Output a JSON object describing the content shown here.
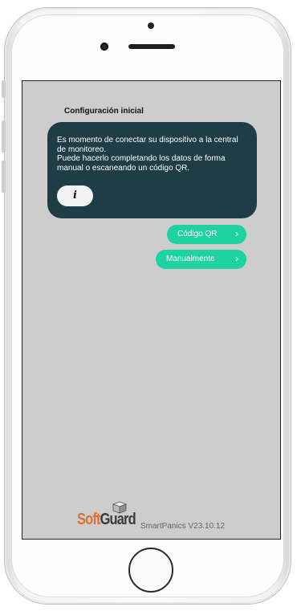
{
  "screen": {
    "title": "Configuración inicial",
    "info_card": {
      "text": "Es momento de conectar su dispositivo a la central\nde monitoreo.\nPuede hacerlo completando los datos de forma\nmanual o escaneando un código QR.",
      "info_button_label": "i"
    },
    "actions": [
      {
        "label": "Código QR",
        "icon": "chevron-right-icon"
      },
      {
        "label": "Manualmente",
        "icon": "chevron-right-icon"
      }
    ],
    "footer": {
      "logo_text_part1": "Soft",
      "logo_text_part2": "Guard",
      "version": "SmartPanics V23.10.12"
    }
  },
  "colors": {
    "card_background": "#1e3d46",
    "accent": "#1ed3a0",
    "screen_background": "#cdcdcd",
    "logo_orange": "#e0702a"
  }
}
